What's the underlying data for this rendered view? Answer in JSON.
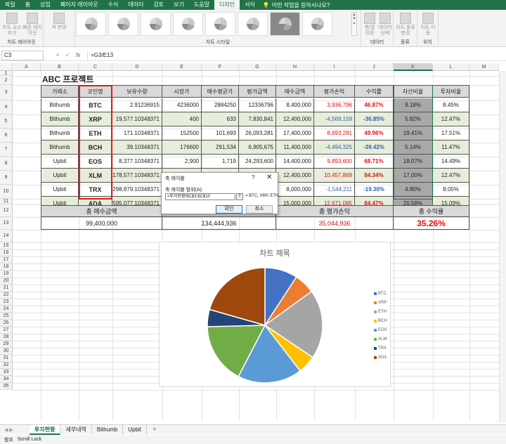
{
  "ribbon": {
    "tabs": [
      "파일",
      "홈",
      "삽입",
      "페이지 레이아웃",
      "수식",
      "데이터",
      "검토",
      "보기",
      "도움말",
      "디자인",
      "서식"
    ],
    "active_tab": "디자인",
    "tell_me": "어떤 작업을 원하시나요?",
    "groups": {
      "layout": {
        "label": "차트 레이아웃",
        "btn1": "차트 요소 추가",
        "btn2": "빠른 레이아웃"
      },
      "color": {
        "btn": "색 변경"
      },
      "styles": {
        "label": "차트 스타일"
      },
      "data": {
        "label": "데이터",
        "btn1": "행/열 전환",
        "btn2": "데이터 선택"
      },
      "type": {
        "label": "종류",
        "btn": "차트 종류 변경"
      },
      "location": {
        "label": "위치",
        "btn": "차트 이동"
      }
    }
  },
  "formula_bar": {
    "name_box": "C3",
    "fx": "fx",
    "formula": "=G3/E13",
    "cancel": "×",
    "enter": "✓"
  },
  "grid": {
    "columns": [
      "A",
      "B",
      "C",
      "D",
      "E",
      "F",
      "G",
      "H",
      "I",
      "J",
      "K",
      "L",
      "M"
    ],
    "rows": [
      "1",
      "2",
      "3",
      "4",
      "5",
      "6",
      "7",
      "8",
      "9",
      "10",
      "11",
      "12",
      "13",
      "14",
      "15",
      "16",
      "17",
      "18",
      "19",
      "20",
      "21",
      "22",
      "23",
      "24",
      "25",
      "26",
      "27",
      "28",
      "29",
      "30",
      "31",
      "32",
      "33",
      "34",
      "35"
    ]
  },
  "sheet_title": "ABC 프로젝트",
  "table": {
    "headers": [
      "거래소",
      "코인명",
      "보유수량",
      "시장가",
      "매수평균가",
      "평가금액",
      "매수금액",
      "평가손익",
      "수익률",
      "자산비율",
      "투자비율"
    ],
    "rows": [
      [
        "Bithumb",
        "BTC",
        "2.91236915",
        "4236000",
        "2884250",
        "12336796",
        "8,400,000",
        "3,936,796",
        "46.87%",
        "9.18%",
        "8.45%"
      ],
      [
        "Bithumb",
        "XRP",
        "19,577.10348371",
        "400",
        "633",
        "7,830,841",
        "12,400,000",
        "-4,569,159",
        "-36.85%",
        "5.82%",
        "12.47%"
      ],
      [
        "Bithumb",
        "ETH",
        "171.10348371",
        "152500",
        "101,693",
        "26,093,281",
        "17,400,000",
        "8,693,281",
        "49.96%",
        "19.41%",
        "17.51%"
      ],
      [
        "Bithumb",
        "BCH",
        "39.10348371",
        "176600",
        "291,534",
        "6,905,675",
        "11,400,000",
        "-4,494,325",
        "-39.42%",
        "5.14%",
        "11.47%"
      ],
      [
        "Upbit",
        "EOS",
        "8,377.10348371",
        "2,900",
        "1,719",
        "24,293,600",
        "14,400,000",
        "9,893,600",
        "68.71%",
        "18.07%",
        "14.49%"
      ],
      [
        "Upbit",
        "XLM",
        "178,577.10348371",
        "128",
        "69",
        "22,857,869",
        "12,400,000",
        "10,457,869",
        "84.34%",
        "17.00%",
        "12.47%"
      ],
      [
        "Upbit",
        "TRX",
        "298,879.10348371",
        "",
        "",
        "",
        "8,000,000",
        "-1,544,211",
        "-19.30%",
        "4.80%",
        "8.05%"
      ],
      [
        "Upbit",
        "ADA",
        "595,077.10348371",
        "",
        "",
        "",
        "15,000,000",
        "12,671,085",
        "84.47%",
        "20.58%",
        "15.09%"
      ]
    ]
  },
  "summary": {
    "buy_label": "총 매수금액",
    "buy_value": "99,400,000",
    "eval_value": "134,444,936",
    "profit_label": "총 평가손익",
    "profit_value": "35,044,936",
    "return_label": "총 수익률",
    "return_value": "35.26%"
  },
  "dialog": {
    "title": "축 레이블",
    "help": "?",
    "close": "✕",
    "label": "축 레이블 범위(A):",
    "input": "=투자현황!$C$3:$C$10",
    "preview": "= BTC, XRP, ETH",
    "ok": "확인",
    "cancel": "취소"
  },
  "chart_data": {
    "type": "pie",
    "title": "차트 제목",
    "categories": [
      "BTC",
      "XRP",
      "ETH",
      "BCH",
      "EOS",
      "XLM",
      "TRX",
      "ADA"
    ],
    "values": [
      9.18,
      5.82,
      19.41,
      5.14,
      18.07,
      17.0,
      4.8,
      20.58
    ],
    "colors": [
      "#4472c4",
      "#ed7d31",
      "#a5a5a5",
      "#ffc000",
      "#5b9bd5",
      "#70ad47",
      "#264478",
      "#9e480e"
    ],
    "legend": "right"
  },
  "sheets": {
    "tabs": [
      "투자현황",
      "세부내역",
      "Bithumb",
      "Upbit"
    ],
    "active": "투자현황",
    "add": "+"
  },
  "status": {
    "mode": "참조",
    "scroll_lock": "Scroll Lock"
  }
}
